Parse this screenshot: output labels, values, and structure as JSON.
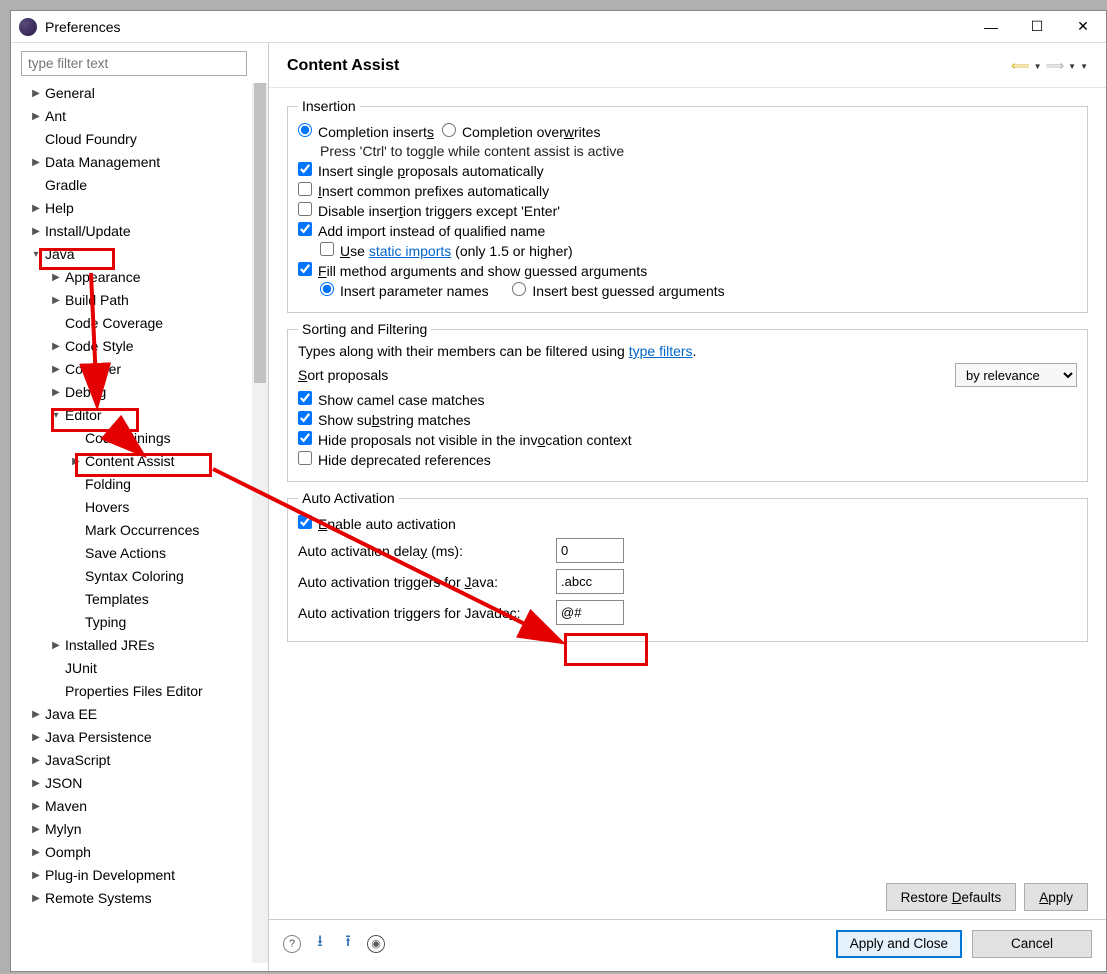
{
  "window": {
    "title": "Preferences"
  },
  "filter_placeholder": "type filter text",
  "tree": {
    "general": "General",
    "ant": "Ant",
    "cloud": "Cloud Foundry",
    "data": "Data Management",
    "gradle": "Gradle",
    "help": "Help",
    "install": "Install/Update",
    "java": "Java",
    "appearance": "Appearance",
    "build": "Build Path",
    "coverage": "Code Coverage",
    "codestyle": "Code Style",
    "compiler": "Compiler",
    "debug": "Debug",
    "editor": "Editor",
    "codeminings": "Code Minings",
    "contentassist": "Content Assist",
    "folding": "Folding",
    "hovers": "Hovers",
    "markocc": "Mark Occurrences",
    "saveactions": "Save Actions",
    "syntax": "Syntax Coloring",
    "templates": "Templates",
    "typing": "Typing",
    "installed": "Installed JREs",
    "junit": "JUnit",
    "propfiles": "Properties Files Editor",
    "javaee": "Java EE",
    "javapersist": "Java Persistence",
    "javascript": "JavaScript",
    "json": "JSON",
    "maven": "Maven",
    "mylyn": "Mylyn",
    "oomph": "Oomph",
    "plugin": "Plug-in Development",
    "remote": "Remote Systems"
  },
  "page": {
    "title": "Content Assist",
    "groups": {
      "insertion": {
        "legend": "Insertion",
        "completion_inserts": "Completion inserts",
        "completion_overwrites": "Completion overwrites",
        "toggle_hint": "Press 'Ctrl' to toggle while content assist is active",
        "single_proposals": "Insert single proposals automatically",
        "common_prefixes": "Insert common prefixes automatically",
        "disable_triggers": "Disable insertion triggers except 'Enter'",
        "add_import": "Add import instead of qualified name",
        "use_static_pre": "Use ",
        "use_static_link": "static imports",
        "use_static_post": " (only 1.5 or higher)",
        "fill_method": "Fill method arguments and show guessed arguments",
        "insert_param": "Insert parameter names",
        "insert_best": "Insert best guessed arguments"
      },
      "sorting": {
        "legend": "Sorting and Filtering",
        "typefilters_pre": "Types along with their members can be filtered using ",
        "typefilters_link": "type filters",
        "sort_label": "Sort proposals",
        "sort_value": "by relevance",
        "camel": "Show camel case matches",
        "substring": "Show substring matches",
        "hidenotvisible": "Hide proposals not visible in the invocation context",
        "hidedeprecated": "Hide deprecated references"
      },
      "auto": {
        "legend": "Auto Activation",
        "enable": "Enable auto activation",
        "delay_label": "Auto activation delay (ms):",
        "delay_value": "0",
        "java_label": "Auto activation triggers for Java:",
        "java_value": ".abcc",
        "javadoc_label": "Auto activation triggers for Javadoc:",
        "javadoc_value": "@#"
      }
    },
    "buttons": {
      "restore": "Restore Defaults",
      "apply": "Apply",
      "applyclose": "Apply and Close",
      "cancel": "Cancel"
    }
  }
}
